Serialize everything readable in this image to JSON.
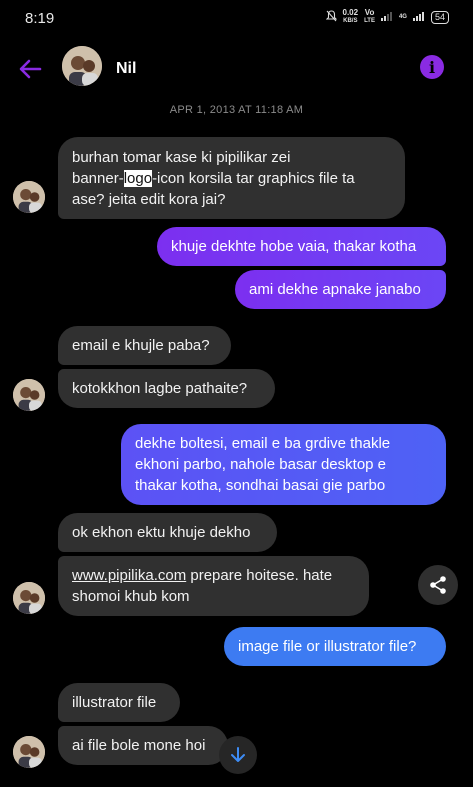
{
  "status": {
    "time": "8:19",
    "net_speed": "0.02",
    "net_unit": "KB/S",
    "volte": "Vo",
    "lte": "LTE",
    "signal": "4G",
    "battery": "54"
  },
  "header": {
    "contact_name": "Nil"
  },
  "timestamp": "APR 1, 2013 AT 11:18 AM",
  "messages": {
    "m1": {
      "line1": "burhan tomar kase ki pipilikar zei",
      "line2a": "banner-",
      "line2b": "logo",
      "line2c": "-icon korsila tar graphics file ta",
      "line3": "ase? jeita edit kora jai?"
    },
    "m2": "khuje dekhte hobe vaia, thakar kotha",
    "m3": "ami dekhe apnake janabo",
    "m4": "email e khujle paba?",
    "m5": "kotokkhon lagbe pathaite?",
    "m6": {
      "line1": "dekhe boltesi, email e ba grdive  thakle",
      "line2": "ekhoni parbo, nahole basar desktop e",
      "line3": "thakar kotha, sondhai basai gie parbo"
    },
    "m7": "ok ekhon ektu khuje dekho",
    "m8": {
      "link": "www.pipilika.com",
      "line1rest": " prepare hoitese. hate",
      "line2": "shomoi khub kom"
    },
    "m9": "image file or illustrator file?",
    "m10": "illustrator file",
    "m11": "ai file bole mone hoi"
  },
  "icons": {
    "back": "arrow-left-icon",
    "info": "info-icon",
    "share": "share-icon",
    "scroll": "arrow-down-icon"
  },
  "colors": {
    "accent": "#8a2be2",
    "incoming_bubble": "#303030",
    "outgoing_start": "#7c2ff0",
    "outgoing_end": "#3d7bf2"
  }
}
